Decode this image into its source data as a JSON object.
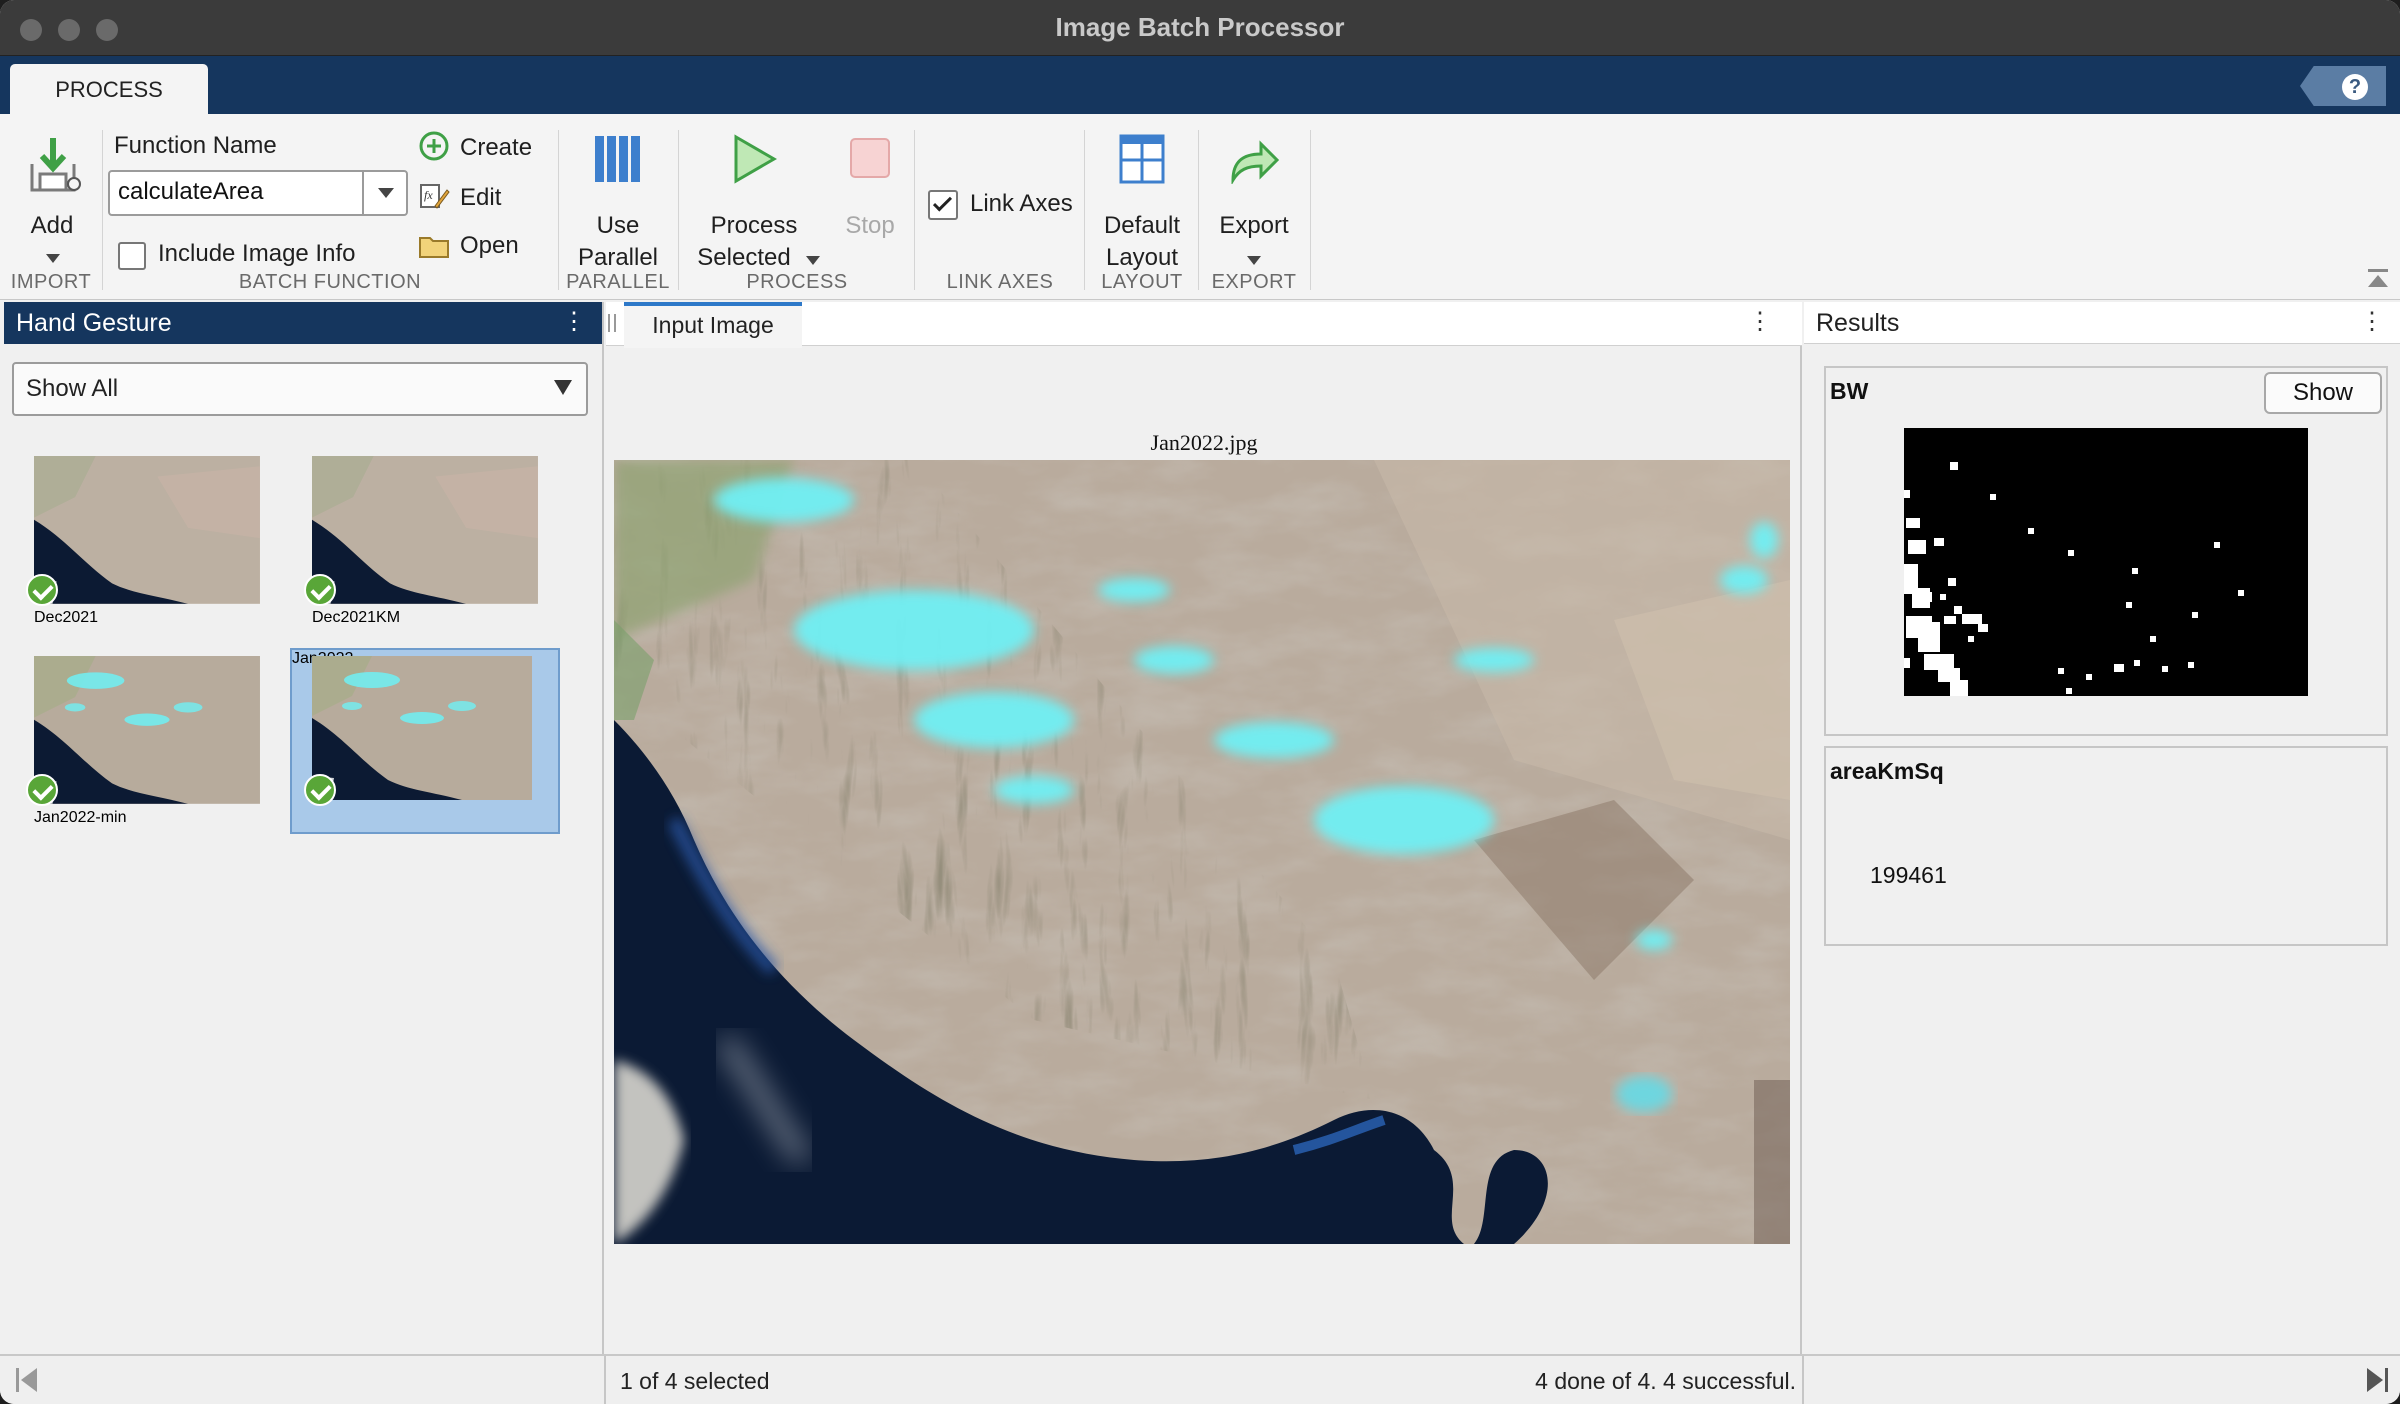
{
  "window": {
    "title": "Image Batch Processor"
  },
  "tabs": {
    "process": "PROCESS",
    "help": "?"
  },
  "ribbon": {
    "import": {
      "add_label": "Add",
      "section": "IMPORT"
    },
    "batch_function": {
      "function_name_label": "Function Name",
      "function_name_value": "calculateArea",
      "include_image_info": "Include Image Info",
      "include_image_info_checked": false,
      "create": "Create",
      "edit": "Edit",
      "open": "Open",
      "section": "BATCH FUNCTION"
    },
    "parallel": {
      "line1": "Use",
      "line2": "Parallel",
      "section": "PARALLEL"
    },
    "process": {
      "line1": "Process",
      "line2": "Selected",
      "stop": "Stop",
      "section": "PROCESS"
    },
    "link_axes": {
      "label": "Link Axes",
      "checked": true,
      "section": "LINK AXES"
    },
    "layout": {
      "line1": "Default",
      "line2": "Layout",
      "section": "LAYOUT"
    },
    "export": {
      "label": "Export",
      "section": "EXPORT"
    }
  },
  "left_panel": {
    "title": "Hand Gesture",
    "filter": "Show All",
    "images": [
      {
        "name": "Dec2021",
        "status": "done",
        "selected": false
      },
      {
        "name": "Dec2021KM",
        "status": "done",
        "selected": false
      },
      {
        "name": "Jan2022-min",
        "status": "done",
        "selected": false
      },
      {
        "name": "Jan2022",
        "status": "done",
        "selected": true
      }
    ]
  },
  "center_panel": {
    "tab": "Input Image",
    "image_title": "Jan2022.jpg"
  },
  "right_panel": {
    "title": "Results",
    "bw": {
      "label": "BW",
      "button": "Show"
    },
    "area": {
      "label": "areaKmSq",
      "value": "199461"
    }
  },
  "status": {
    "left": "1 of 4 selected",
    "right": "4 done of 4. 4 successful."
  },
  "colors": {
    "header_blue": "#15365e",
    "selected_thumb": "#a9c9e9",
    "check_green": "#59a638",
    "snow": "#6ff0f4"
  }
}
